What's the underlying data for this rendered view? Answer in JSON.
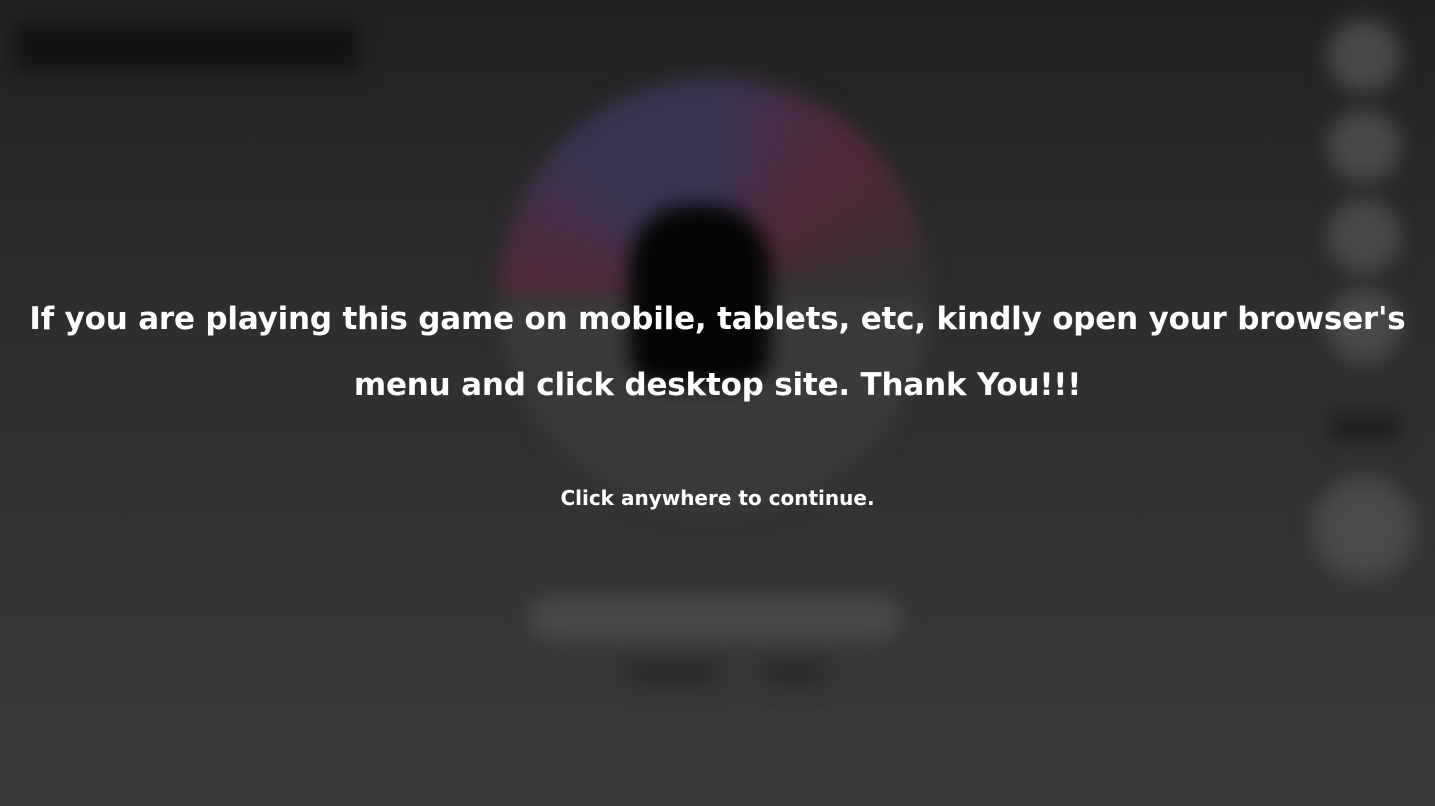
{
  "notice": {
    "message": "If you are playing this game on mobile, tablets, etc, kindly open your browser's menu and click desktop site. Thank You!!!",
    "continue_hint": "Click anywhere to continue."
  },
  "colors": {
    "text": "#ffffff",
    "background": "#2e2e2e",
    "ball_red": "#54283a",
    "ball_purple": "#3a3550"
  }
}
